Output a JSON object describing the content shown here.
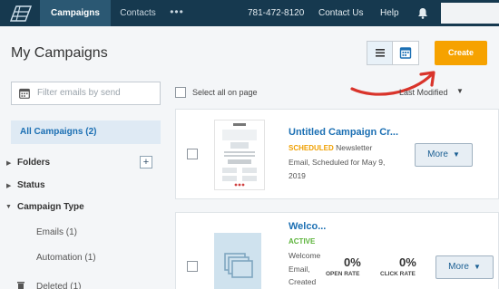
{
  "nav": {
    "tabs": [
      {
        "label": "Campaigns"
      },
      {
        "label": "Contacts"
      }
    ],
    "more": "•••",
    "phone": "781-472-8120",
    "contact_us": "Contact Us",
    "help": "Help"
  },
  "header": {
    "title": "My Campaigns",
    "create_label": "Create"
  },
  "sidebar": {
    "filter_placeholder": "Filter emails by send",
    "all_campaigns": "All Campaigns (2)",
    "folders": "Folders",
    "folders_add": "+",
    "status": "Status",
    "campaign_type": "Campaign Type",
    "emails": "Emails (1)",
    "automation": "Automation (1)",
    "deleted": "Deleted (1)"
  },
  "list": {
    "select_all": "Select all on page",
    "sort_label": "Last Modified"
  },
  "campaigns": [
    {
      "title": "Untitled Campaign Cr...",
      "status": "SCHEDULED",
      "line1_rest": " Newsletter",
      "line2": "Email, Scheduled for May 9,",
      "line3": "2019",
      "more_label": "More"
    },
    {
      "title": "Welco...",
      "status": "ACTIVE",
      "line1": "Welcome",
      "line2": "Email,",
      "line3": "Created",
      "open_rate_value": "0%",
      "open_rate_label": "OPEN RATE",
      "click_rate_value": "0%",
      "click_rate_label": "CLICK RATE",
      "more_label": "More"
    }
  ],
  "colors": {
    "nav_bg": "#16394f",
    "accent_blue": "#1b6fb3",
    "create_orange": "#f6a200",
    "scheduled": "#f0a000",
    "active": "#5bb33a",
    "arrow_red": "#d9342b"
  }
}
